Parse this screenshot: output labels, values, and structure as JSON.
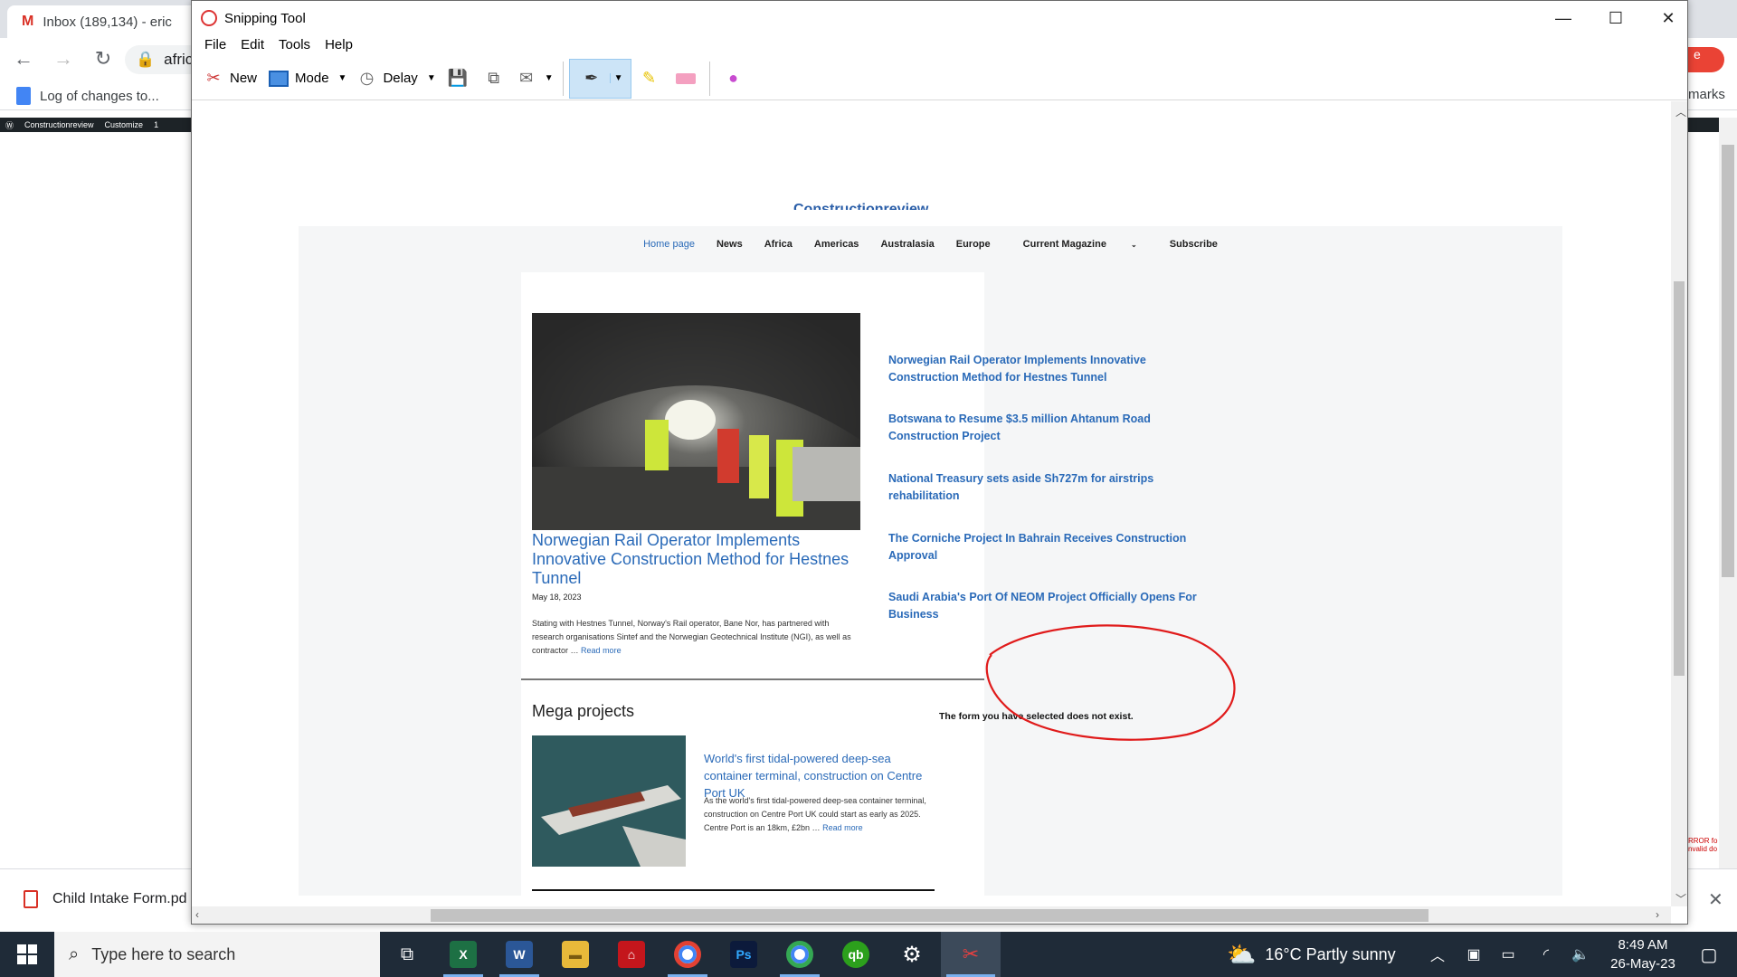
{
  "browser": {
    "tab_title": "Inbox (189,134) - eric",
    "address_fragment": "afric",
    "bookmark_label": "Log of changes to...",
    "right_bookmarks_fragment": "marks",
    "right_button_fragment": "e",
    "wp_site": "Constructionreview",
    "wp_customize": "Customize",
    "wp_count": "1",
    "error_fragment": "RROR fo nvalid do",
    "download_file": "Child Intake Form.pd"
  },
  "snip": {
    "title": "Snipping Tool",
    "menu": [
      "File",
      "Edit",
      "Tools",
      "Help"
    ],
    "toolbar": {
      "new": "New",
      "mode": "Mode",
      "delay": "Delay"
    }
  },
  "site": {
    "logo": "Constructionreview",
    "nav": [
      "Home page",
      "News",
      "Africa",
      "Americas",
      "Australasia",
      "Europe",
      "Current Magazine",
      "Subscribe"
    ],
    "hero": {
      "title": "Norwegian Rail Operator Implements Innovative Construction Method for Hestnes Tunnel",
      "date": "May 18, 2023",
      "excerpt": "Stating with Hestnes Tunnel, Norway's Rail operator, Bane Nor, has partnered with research organisations Sintef and the Norwegian Geotechnical Institute (NGI), as well as contractor …",
      "read_more": "Read more"
    },
    "side_links": [
      "Norwegian Rail Operator Implements Innovative Construction Method for Hestnes Tunnel",
      "Botswana to Resume $3.5 million Ahtanum Road Construction Project",
      "National Treasury sets aside Sh727m for airstrips rehabilitation",
      "The Corniche Project In Bahrain Receives Construction Approval",
      "Saudi Arabia's Port Of NEOM Project Officially Opens For Business"
    ],
    "mega": {
      "heading": "Mega projects",
      "title": "World's first tidal-powered deep-sea container terminal, construction on Centre Port UK",
      "excerpt": "As the world's first tidal-powered deep-sea container terminal, construction on Centre Port UK could start as early as 2025. Centre Port is an 18km, £2bn …",
      "read_more": "Read more"
    },
    "form_message": "The form you have selected does not exist."
  },
  "taskbar": {
    "search_placeholder": "Type here to search",
    "weather": "16°C  Partly sunny",
    "time": "8:49 AM",
    "date": "26-May-23"
  },
  "colors": {
    "link": "#2a6ab8",
    "annotation": "#e01b1b",
    "taskbar": "#1f2b38"
  }
}
